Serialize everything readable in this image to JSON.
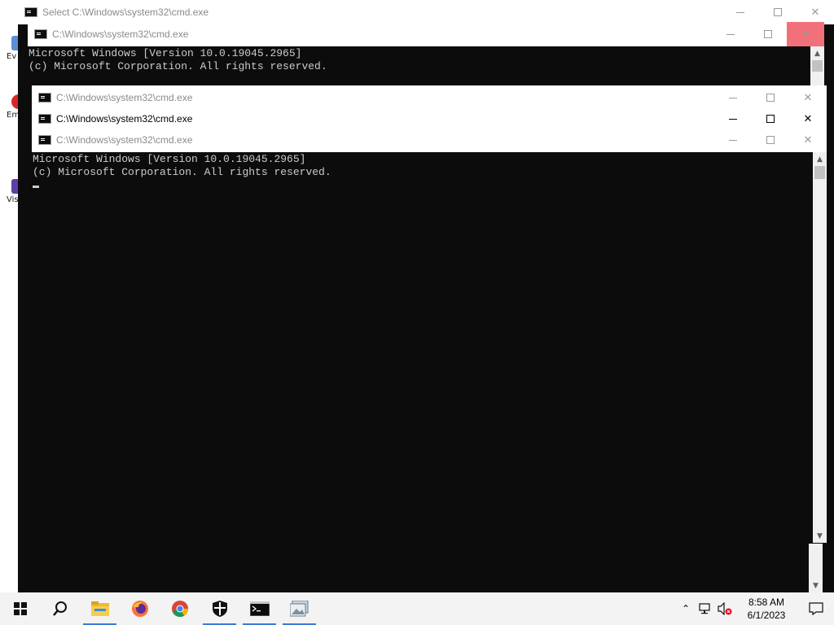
{
  "desktop": {
    "icons": [
      {
        "label": "Ev",
        "color": "#5b8fd6"
      },
      {
        "label": "Em",
        "color": "#d62828"
      },
      {
        "label": "Vis",
        "color": "#5e3fa8"
      }
    ]
  },
  "windows": {
    "back_window": {
      "title": "Select C:\\Windows\\system32\\cmd.exe"
    },
    "window_a": {
      "title": "C:\\Windows\\system32\\cmd.exe",
      "lines": [
        "Microsoft Windows [Version 10.0.19045.2965]",
        "(c) Microsoft Corporation. All rights reserved."
      ]
    },
    "window_b": {
      "title": "C:\\Windows\\system32\\cmd.exe"
    },
    "window_c": {
      "title": "C:\\Windows\\system32\\cmd.exe"
    },
    "window_d": {
      "title": "C:\\Windows\\system32\\cmd.exe",
      "lines": [
        "Microsoft Windows [Version 10.0.19045.2965]",
        "(c) Microsoft Corporation. All rights reserved."
      ]
    },
    "controls": {
      "minimize": "—",
      "maximize": "☐",
      "close": "✕"
    }
  },
  "taskbar": {
    "items": [
      "start-icon",
      "search-icon",
      "file-explorer-icon",
      "firefox-icon",
      "chrome-icon",
      "windows-security-icon",
      "command-prompt-icon",
      "photos-icon"
    ],
    "tray": {
      "time": "8:58 AM",
      "date": "6/1/2023"
    },
    "colors": {
      "accent": "#3a7bd5"
    }
  }
}
